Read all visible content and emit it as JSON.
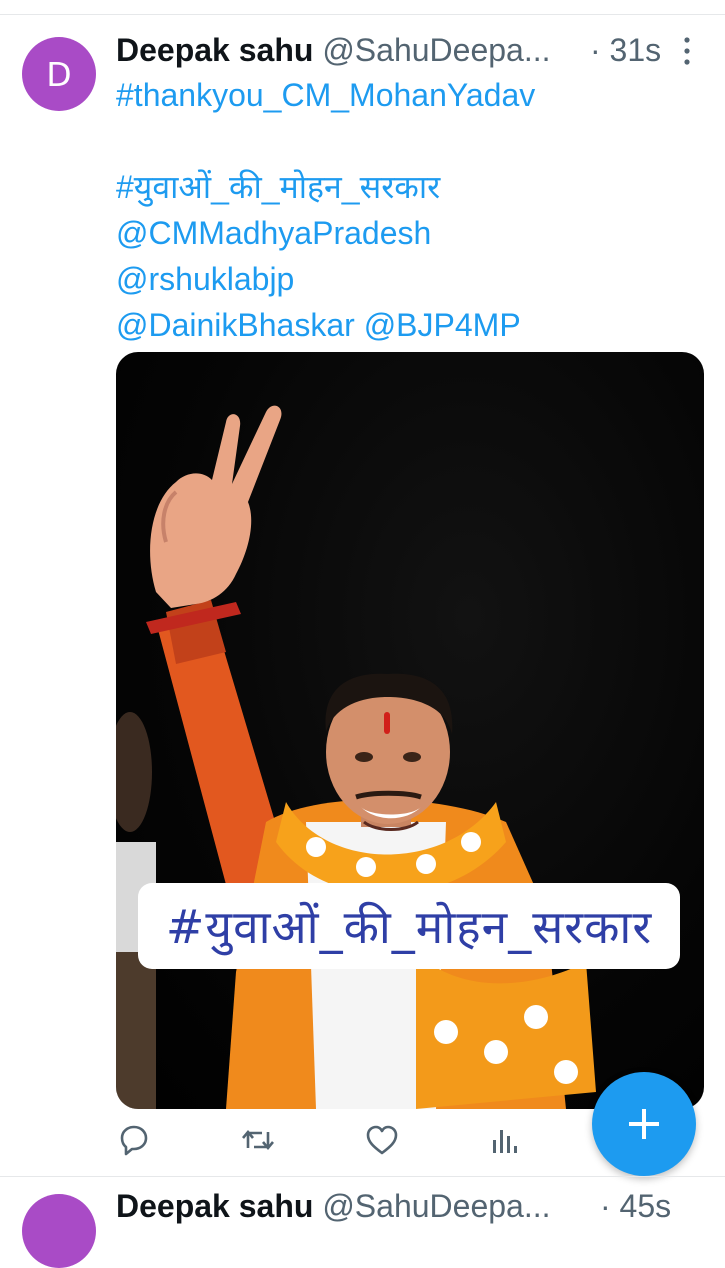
{
  "tweet": {
    "avatar_letter": "D",
    "display_name": "Deepak sahu",
    "handle": "@SahuDeepa...",
    "time": "· 31s",
    "lines": [
      "#thankyou_CM_MohanYadav",
      "",
      "#युवाओं_की_मोहन_सरकार",
      "@CMMadhyaPradesh",
      "@rshuklabjp"
    ],
    "mention_a": "@DainikBhaskar",
    "mention_b": "@BJP4MP",
    "image_banner": "#युवाओं_की_मोहन_सरकार"
  },
  "next_tweet": {
    "display_name": "Deepak sahu",
    "handle": "@SahuDeepa...",
    "time": "· 45s"
  },
  "icons": {
    "more": "more-vertical-icon",
    "reply": "reply-icon",
    "retweet": "retweet-icon",
    "like": "like-icon",
    "views": "views-icon",
    "compose": "compose-plus-icon"
  },
  "colors": {
    "accent": "#1d9bf0",
    "avatar": "#a94bc6",
    "text": "#0f1419",
    "muted": "#536471",
    "banner_text": "#2f3fa6"
  }
}
